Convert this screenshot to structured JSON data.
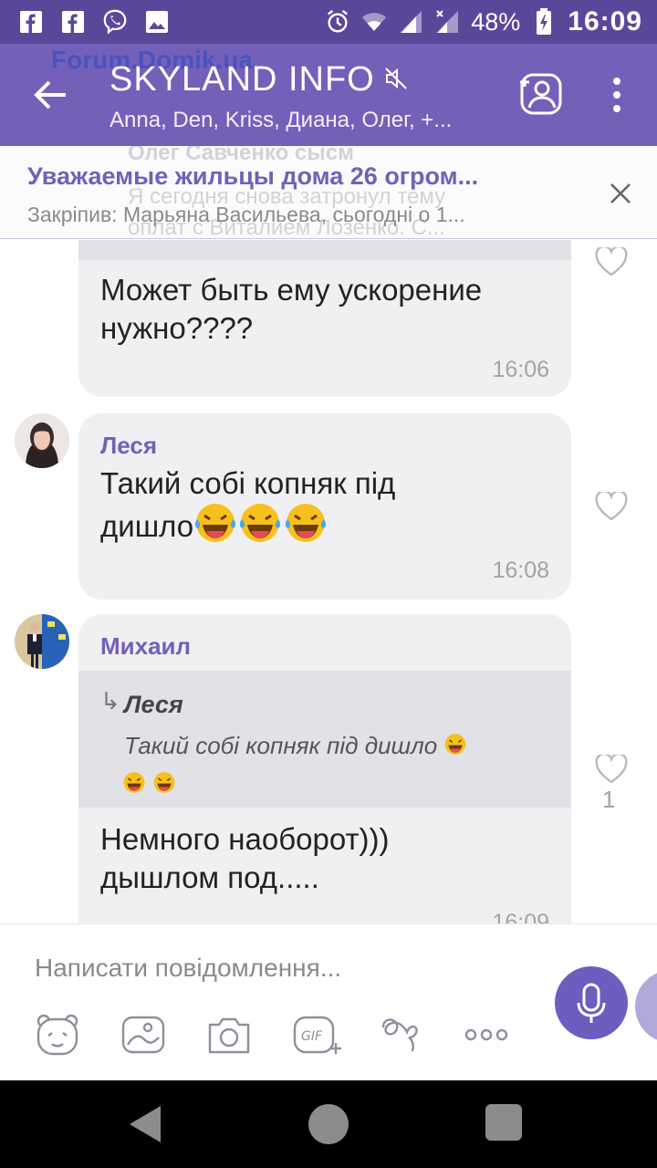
{
  "status_bar": {
    "battery": "48%",
    "time": "16:09"
  },
  "app_bar": {
    "watermark": "Forum.Domik.ua",
    "title": "SKYLAND INFO",
    "subtitle": "Anna, Den, Kriss, Диана, Олег, +..."
  },
  "pinned": {
    "title": "Уважаемые жильцы дома 26 огром...",
    "subtitle": "Закріпив: Марьяна Васильева, сьогодні о 1...",
    "ghost_sender": "Олег Савченко сысм",
    "ghost_line1": "Я сегодня снова затронул тему",
    "ghost_line2": "оплат с Виталием Лозенко. С..."
  },
  "messages": [
    {
      "text_line1": "Может быть ему ускорение",
      "text_line2": "нужно????",
      "time": "16:06"
    },
    {
      "sender": "Леся",
      "text_line1": "Такий собі копняк під",
      "text_line2": "дишло",
      "time": "16:08"
    },
    {
      "sender": "Михаил",
      "quote_sender": "Леся",
      "quote_text": "Такий собі копняк під дишло",
      "text_line1": "Немного наоборот)))",
      "text_line2": "дышлом под.....",
      "time": "16:09",
      "likes": "1"
    }
  ],
  "input": {
    "placeholder": "Написати повідомлення..."
  },
  "colors": {
    "status_bar": "#5b479a",
    "app_bar": "#7360b8",
    "accent": "#7360b8",
    "bubble": "#f0f0f3"
  }
}
